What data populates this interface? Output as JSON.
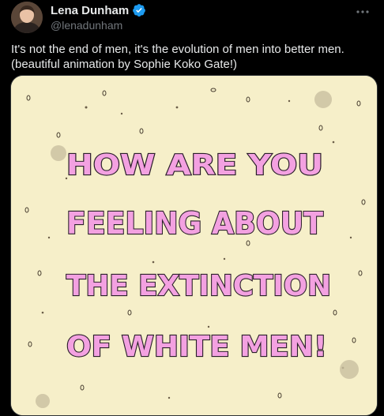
{
  "tweet": {
    "author": {
      "display_name": "Lena Dunham",
      "handle": "@lenadunham",
      "verified": true,
      "avatar_icon": "profile-photo"
    },
    "more_icon": "more-horizontal-icon",
    "text": "It's not the end of men, it's the evolution of men into better men.\n(beautiful animation by Sophie Koko Gate!)",
    "media": {
      "kind": "animation-still",
      "background_color": "#f6efc9",
      "letter_color": "#f3a1e1",
      "lines": [
        "HOW ARE YOU",
        "FEELING ABOUT",
        "THE EXTINCTION",
        "OF WHITE MEN!"
      ]
    }
  },
  "colors": {
    "background": "#000000",
    "text_primary": "#e7e9ea",
    "text_secondary": "#71767b",
    "verified_blue": "#1d9bf0",
    "border": "#2f3336"
  }
}
